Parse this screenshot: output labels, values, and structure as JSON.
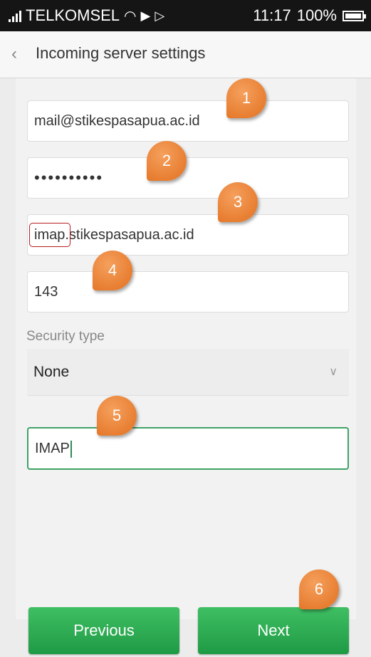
{
  "status_bar": {
    "carrier": "TELKOMSEL",
    "time": "11:17",
    "battery": "100%",
    "battery_level": 1.0
  },
  "header": {
    "back_icon": "chevron-left-icon",
    "title": "Incoming server settings"
  },
  "form": {
    "email": "mail@stikespasapua.ac.id",
    "password_masked": "••••••••••",
    "server": "imap.stikespasapua.ac.id",
    "port": "143",
    "security_label": "Security type",
    "security_value": "None",
    "protocol": "IMAP"
  },
  "buttons": {
    "previous": "Previous",
    "next": "Next"
  },
  "markers": [
    "1",
    "2",
    "3",
    "4",
    "5",
    "6"
  ],
  "colors": {
    "accent_green": "#2a9d4e",
    "marker_orange": "#e8762a",
    "highlight_red": "#b71c1c",
    "active_border": "#3fa267"
  }
}
